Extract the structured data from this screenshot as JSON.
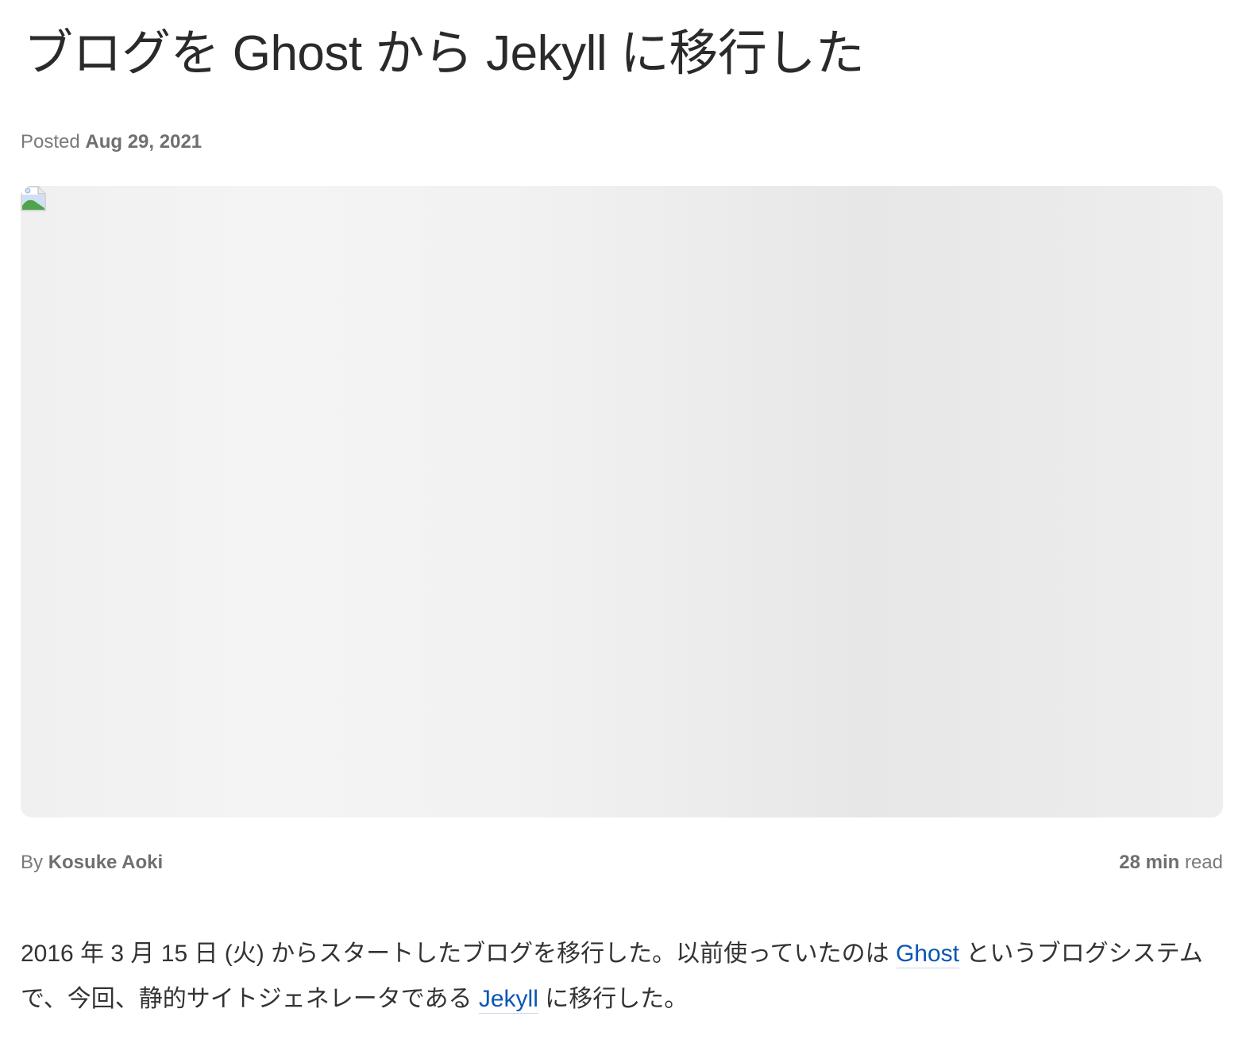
{
  "post": {
    "title": "ブログを Ghost から Jekyll に移行した",
    "meta": {
      "posted_label": "Posted",
      "date": "Aug 29, 2021"
    },
    "preview_image": {
      "icon": "broken-image-icon"
    },
    "byline": {
      "by_label": "By",
      "author": "Kosuke Aoki",
      "read_minutes": "28 min",
      "read_label": "read"
    },
    "body": {
      "paragraph_1": {
        "text_1": "2016 年 3 月 15 日 (火) からスタートしたブログを移行した。以前使っていたのは ",
        "link_1": "Ghost",
        "text_2": " というブログシステムで、今回、静的サイトジェネレータである ",
        "link_2": "Jekyll",
        "text_3": " に移行した。"
      }
    }
  }
}
